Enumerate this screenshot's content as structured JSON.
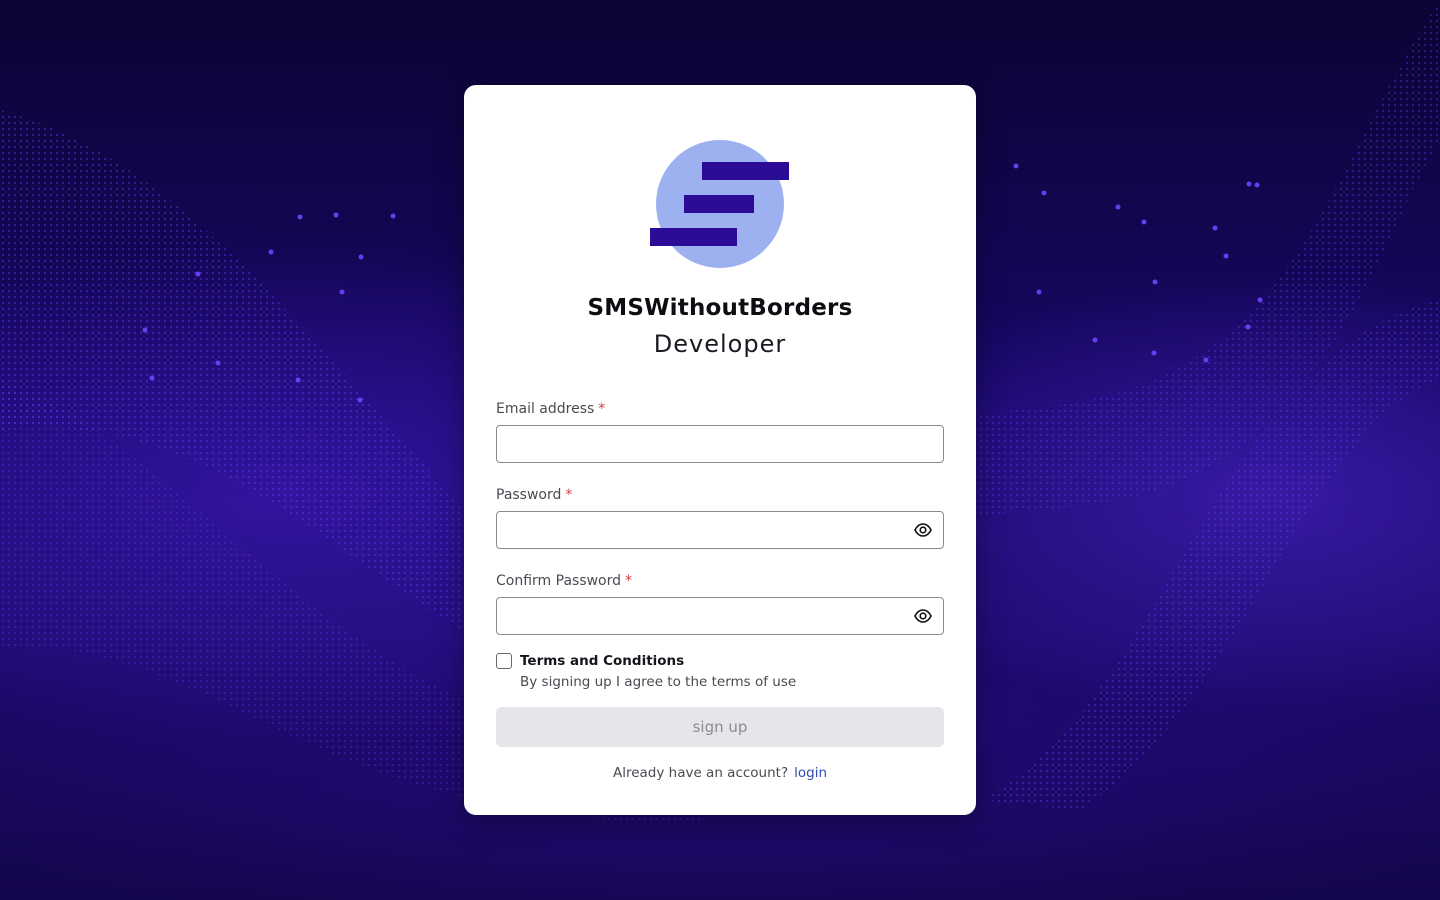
{
  "colors": {
    "background_dark": "#0c0433",
    "background_accent": "#3b1ec8",
    "card_background": "#ffffff",
    "logo_circle": "#9db1f0",
    "logo_bars": "#2c0c96",
    "required_asterisk": "#d6383a",
    "link": "#2d4fb3",
    "button_disabled_bg": "#e5e6ea",
    "button_disabled_text": "#8a8b92"
  },
  "brand": {
    "logo_icon": "smswithoutborders-logo-icon",
    "title": "SMSWithoutBorders",
    "subtitle": "Developer"
  },
  "form": {
    "email": {
      "label": "Email address",
      "required_mark": "*",
      "value": "",
      "placeholder": ""
    },
    "password": {
      "label": "Password",
      "required_mark": "*",
      "value": "",
      "placeholder": "",
      "toggle_icon": "eye-icon"
    },
    "confirm_password": {
      "label": "Confirm Password",
      "required_mark": "*",
      "value": "",
      "placeholder": "",
      "toggle_icon": "eye-icon"
    },
    "terms": {
      "checked": false,
      "title": "Terms and Conditions",
      "description": "By signing up I agree to the terms of use"
    },
    "submit_label": "sign up",
    "submit_disabled": true
  },
  "footer": {
    "prompt": "Already have an account?",
    "link_label": "login"
  }
}
